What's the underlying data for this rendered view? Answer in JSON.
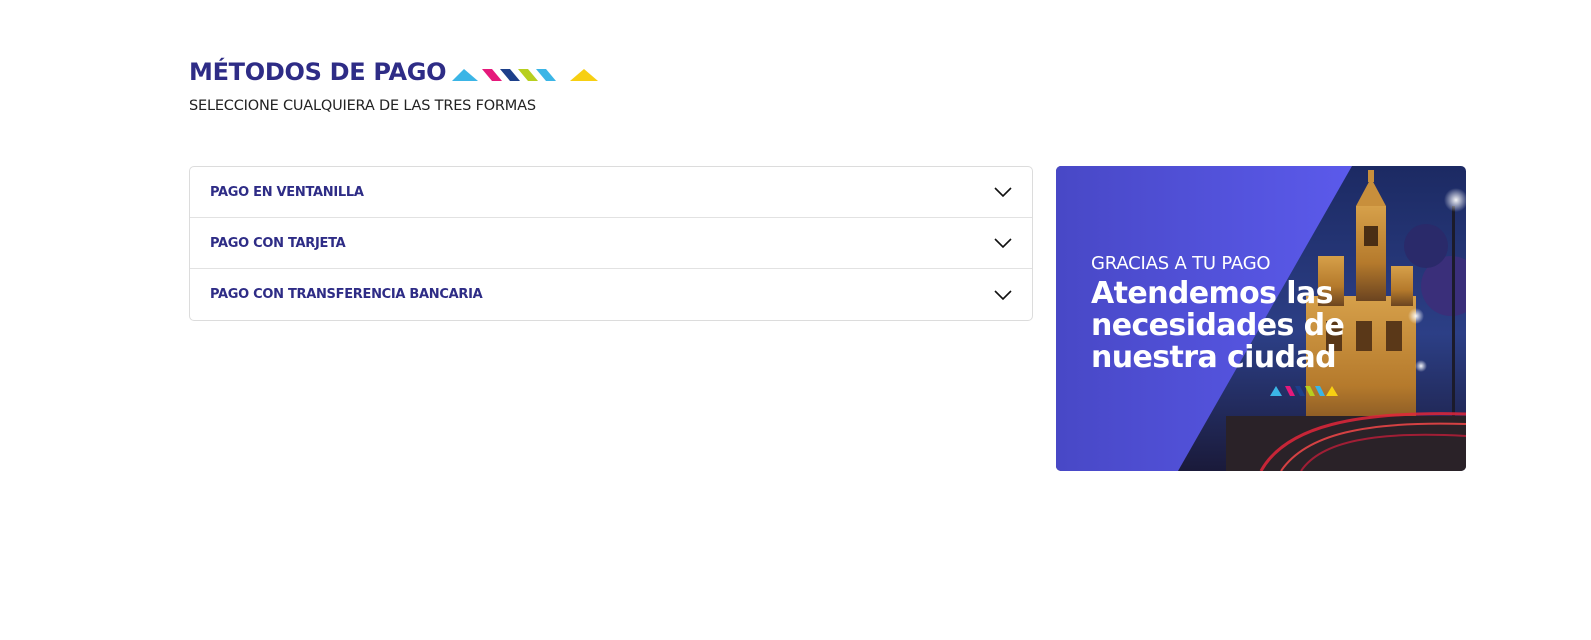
{
  "header": {
    "title": "MÉTODOS DE PAGO",
    "subtitle": "SELECCIONE CUALQUIERA DE LAS TRES FORMAS"
  },
  "accordion": {
    "items": [
      {
        "label": "PAGO EN VENTANILLA",
        "icon": "chevron-down-icon",
        "expanded": false
      },
      {
        "label": "PAGO CON TARJETA",
        "icon": "chevron-down-icon",
        "expanded": false
      },
      {
        "label": "PAGO CON TRANSFERENCIA BANCARIA",
        "icon": "chevron-down-icon",
        "expanded": false
      }
    ]
  },
  "banner": {
    "kicker": "GRACIAS A TU PAGO",
    "headline": "Atendemos las necesidades de nuestra ciudad"
  },
  "colors": {
    "brand_navy": "#2e2c86",
    "banner_purple": "#4f4fd6",
    "stripe_cyan": "#3bb5e6",
    "stripe_magenta": "#e5197b",
    "stripe_dark_blue": "#1d3f8a",
    "stripe_lime": "#b7cf1f",
    "stripe_yellow": "#f7cf12"
  }
}
